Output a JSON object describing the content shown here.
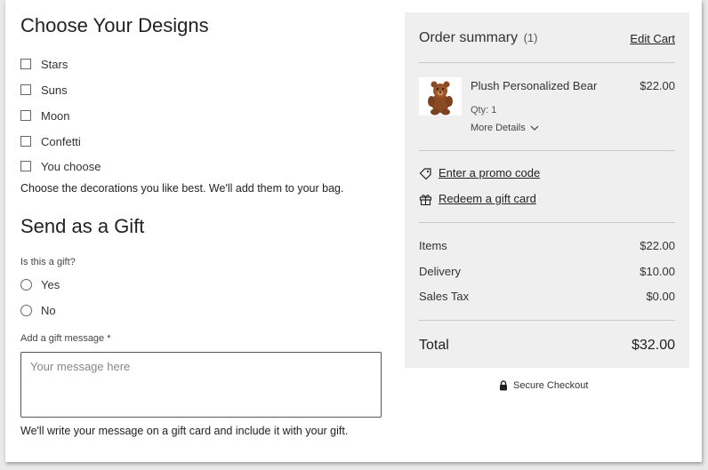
{
  "designs": {
    "title": "Choose Your Designs",
    "options": [
      "Stars",
      "Suns",
      "Moon",
      "Confetti",
      "You choose"
    ],
    "description": "Choose the decorations you like best. We'll add them to your bag."
  },
  "gift": {
    "title": "Send as a Gift",
    "question": "Is this a gift?",
    "options": [
      "Yes",
      "No"
    ],
    "message_label": "Add a gift message *",
    "message_placeholder": "Your message here",
    "message_value": "",
    "footnote": "We'll write your message on a gift card and include it with your gift."
  },
  "summary": {
    "title": "Order summary",
    "count": "(1)",
    "edit_cart": "Edit Cart",
    "item": {
      "name": "Plush Personalized Bear",
      "price": "$22.00",
      "qty": "Qty: 1",
      "more_details": "More Details",
      "image_icon": "teddy-bear-icon"
    },
    "promo_label": "Enter a promo code",
    "gift_card_label": "Redeem a gift card",
    "rows": [
      {
        "label": "Items",
        "value": "$22.00"
      },
      {
        "label": "Delivery",
        "value": "$10.00"
      },
      {
        "label": "Sales Tax",
        "value": "$0.00"
      }
    ],
    "total_label": "Total",
    "total_value": "$32.00"
  },
  "secure_checkout": "Secure Checkout"
}
